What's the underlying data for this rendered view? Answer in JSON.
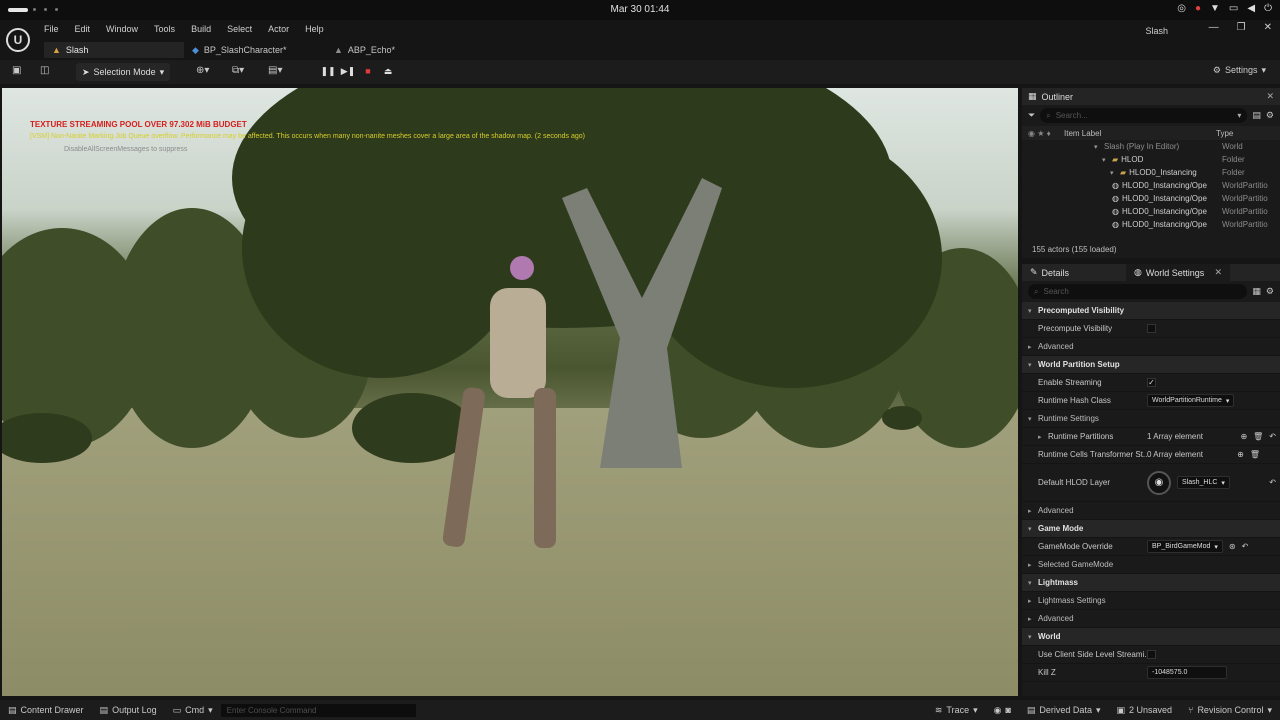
{
  "os": {
    "clock": "Mar 30  01:44"
  },
  "menu": {
    "items": [
      "File",
      "Edit",
      "Window",
      "Tools",
      "Build",
      "Select",
      "Actor",
      "Help"
    ],
    "project_name": "Slash"
  },
  "tabs": [
    {
      "label": "Slash",
      "icon": "level-icon"
    },
    {
      "label": "BP_SlashCharacter*",
      "icon": "blueprint-icon"
    },
    {
      "label": "ABP_Echo*",
      "icon": "anim-blueprint-icon"
    }
  ],
  "toolbar": {
    "mode_label": "Selection Mode",
    "settings_label": "Settings"
  },
  "viewport": {
    "warning_texture": "TEXTURE STREAMING POOL OVER 97.302 MiB BUDGET",
    "warning_vsm": "[VSM] Non-Nanite Marking Job Queue overflow. Performance may be affected. This occurs when many non-nanite meshes cover a large area of the shadow map. (2 seconds ago)",
    "disable_hint": "DisableAllScreenMessages to suppress"
  },
  "outliner": {
    "title": "Outliner",
    "search_placeholder": "Search...",
    "col_label": "Item Label",
    "col_type": "Type",
    "rows": [
      {
        "label": "Slash (Play In Editor)",
        "type": "World"
      },
      {
        "label": "HLOD",
        "type": "Folder"
      },
      {
        "label": "HLOD0_Instancing",
        "type": "Folder"
      },
      {
        "label": "HLOD0_Instancing/Ope",
        "type": "WorldPartitio"
      },
      {
        "label": "HLOD0_Instancing/Ope",
        "type": "WorldPartitio"
      },
      {
        "label": "HLOD0_Instancing/Ope",
        "type": "WorldPartitio"
      },
      {
        "label": "HLOD0_Instancing/Ope",
        "type": "WorldPartitio"
      }
    ],
    "actor_count": "155 actors (155 loaded)"
  },
  "details": {
    "tab_details": "Details",
    "tab_world_settings": "World Settings",
    "search_placeholder": "Search",
    "sec_precomputed": "Precomputed Visibility",
    "precompute_visibility": "Precompute Visibility",
    "advanced": "Advanced",
    "sec_world_partition": "World Partition Setup",
    "enable_streaming": "Enable Streaming",
    "runtime_hash_class": "Runtime Hash Class",
    "runtime_hash_value": "WorldPartitionRuntime",
    "runtime_settings": "Runtime Settings",
    "runtime_partitions": "Runtime Partitions",
    "runtime_partitions_value": "1 Array element",
    "runtime_cells": "Runtime Cells Transformer St...",
    "runtime_cells_value": "0 Array element",
    "default_hlod": "Default HLOD Layer",
    "default_hlod_value": "Slash_HLC",
    "sec_game_mode": "Game Mode",
    "gamemode_override": "GameMode Override",
    "gamemode_value": "BP_BirdGameMod",
    "selected_gamemode": "Selected GameMode",
    "sec_lightmass": "Lightmass",
    "lightmass_settings": "Lightmass Settings",
    "sec_world": "World",
    "use_client_side": "Use Client Side Level Streami...",
    "kill_z": "Kill Z",
    "kill_z_value": "-1048575.0"
  },
  "statusbar": {
    "content_drawer": "Content Drawer",
    "output_log": "Output Log",
    "cmd": "Cmd",
    "console_placeholder": "Enter Console Command",
    "trace": "Trace",
    "derived_data": "Derived Data",
    "unsaved": "2 Unsaved",
    "revision_control": "Revision Control"
  },
  "colors": {
    "accent_red": "#d61e1e",
    "warning_yellow": "#d6cf2a",
    "folder": "#c9a44a"
  }
}
